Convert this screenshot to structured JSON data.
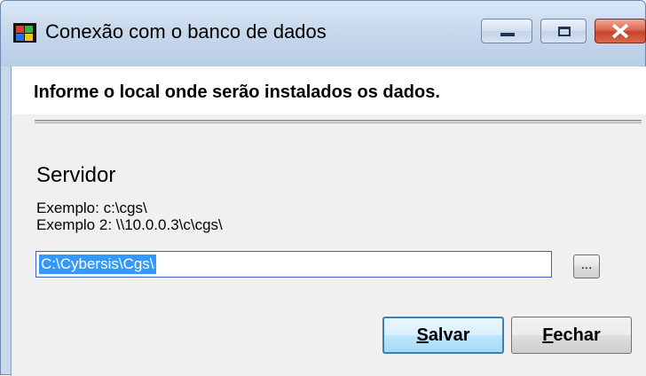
{
  "window": {
    "title": "Conexão com o banco de dados",
    "close_color": "#c7442b"
  },
  "header": {
    "text": "Informe o local onde serão instalados os dados."
  },
  "server": {
    "section_title": "Servidor",
    "example1": "Exemplo:  c:\\cgs\\",
    "example2": "Exemplo 2:  \\\\10.0.0.3\\c\\cgs\\",
    "path_value": "C:\\Cybersis\\Cgs\\",
    "browse_label": "..."
  },
  "buttons": {
    "save_access": "S",
    "save_rest": "alvar",
    "close_access": "F",
    "close_rest": "echar"
  },
  "icons": {
    "app": "windows-flag-icon",
    "minimize": "minimize-icon",
    "maximize": "maximize-icon",
    "close": "close-icon"
  }
}
